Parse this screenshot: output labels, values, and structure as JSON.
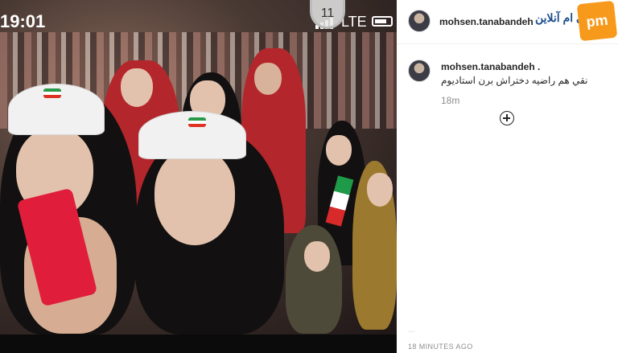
{
  "status_bar": {
    "time": "19:01",
    "network": "LTE",
    "stadium_sign": "11"
  },
  "post": {
    "username": "mohsen.tanabandeh",
    "brand_text": "پی ام آنلاین",
    "logo_text": "pm",
    "comment": {
      "username": "mohsen.tanabandeh .",
      "text": "نقي هم راضيه دختراش برن استاديوم",
      "time": "18m"
    },
    "likes_partial": "...",
    "timestamp": "18 MINUTES AGO"
  },
  "colors": {
    "accent_logo": "#f79a1c",
    "brand_blue": "#1a4d8c",
    "muted": "#8e8e8e"
  }
}
